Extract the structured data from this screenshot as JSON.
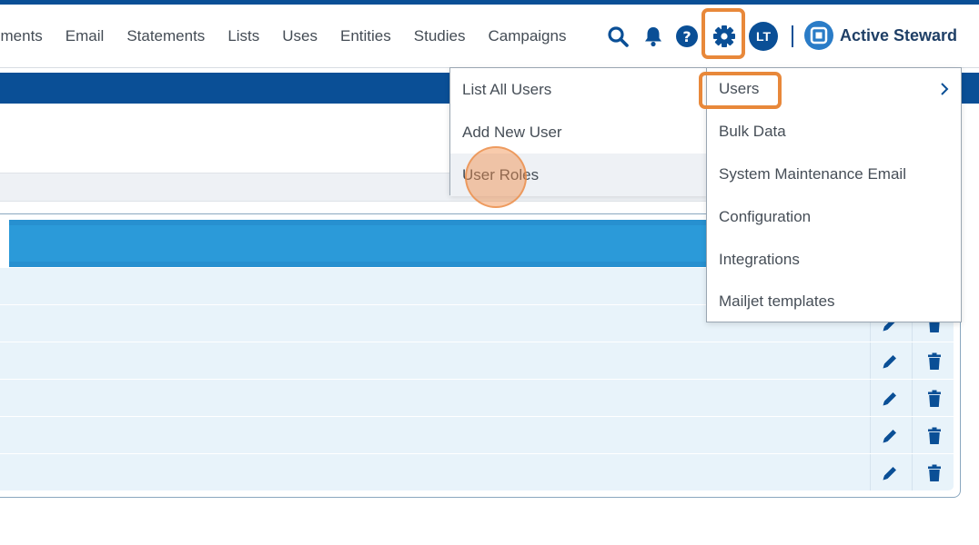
{
  "nav": {
    "links": [
      "ments",
      "Email",
      "Statements",
      "Lists",
      "Uses",
      "Entities",
      "Studies",
      "Campaigns"
    ],
    "avatar_initials": "LT",
    "brand_name": "Active Steward"
  },
  "settings_menu": {
    "items": [
      "Users",
      "Bulk Data",
      "System Maintenance Email",
      "Configuration",
      "Integrations",
      "Mailjet templates"
    ]
  },
  "users_submenu": {
    "items": [
      "List All Users",
      "Add New User",
      "User Roles"
    ]
  },
  "colors": {
    "primary": "#0a4f96",
    "table_header": "#2b9ad9",
    "row_bg": "#e8f3fa",
    "highlight": "#e8883a"
  },
  "icons": [
    "search-icon",
    "bell-icon",
    "help-icon",
    "gear-icon",
    "pencil-icon",
    "trash-icon",
    "chevron-right-icon"
  ]
}
